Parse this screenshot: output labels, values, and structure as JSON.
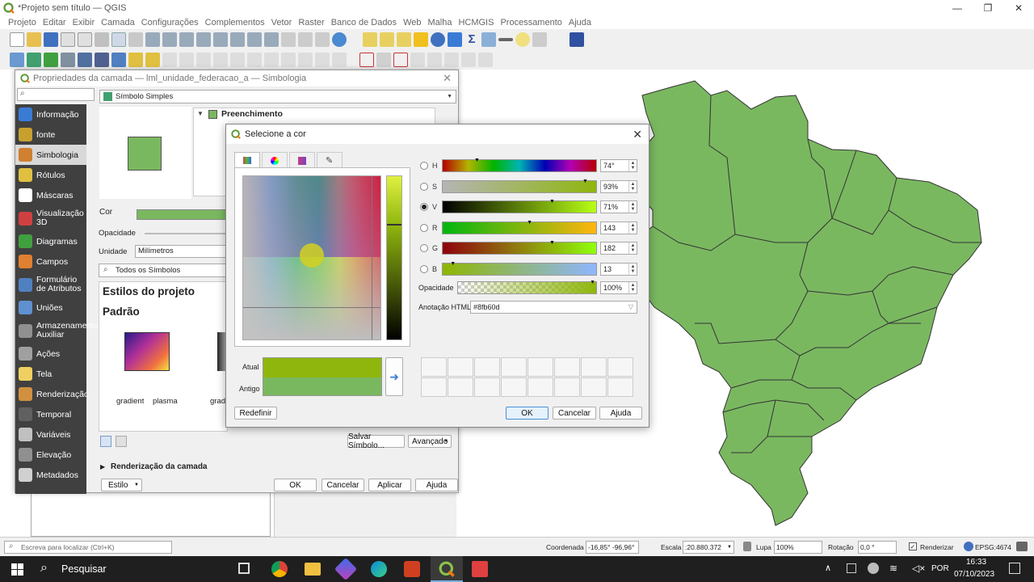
{
  "window": {
    "title": "*Projeto sem título — QGIS",
    "controls": [
      "—",
      "❐",
      "✕"
    ]
  },
  "menu": [
    "Projeto",
    "Editar",
    "Exibir",
    "Camada",
    "Configurações",
    "Complementos",
    "Vetor",
    "Raster",
    "Banco de Dados",
    "Web",
    "Malha",
    "HCMGIS",
    "Processamento",
    "Ajuda"
  ],
  "layer_props": {
    "title": "Propriedades da camada — lml_unidade_federacao_a — Simbologia",
    "renderer": "Símbolo Simples",
    "tree_item": "Preenchimento",
    "sidebar": [
      {
        "label": "Informação",
        "icon": "info-icon",
        "color": "#3a7bd5"
      },
      {
        "label": "fonte",
        "icon": "source-icon",
        "color": "#c8a030"
      },
      {
        "label": "Simbologia",
        "icon": "paintbrush-icon",
        "color": "#d08030",
        "selected": true
      },
      {
        "label": "Rótulos",
        "icon": "abc-label-icon",
        "color": "#e0c040"
      },
      {
        "label": "Máscaras",
        "icon": "abc-mask-icon",
        "color": "#ffffff"
      },
      {
        "label": "Visualização 3D",
        "icon": "cube-3d-icon",
        "color": "#d04040"
      },
      {
        "label": "Diagramas",
        "icon": "diagram-icon",
        "color": "#40a040"
      },
      {
        "label": "Campos",
        "icon": "fields-icon",
        "color": "#e08030"
      },
      {
        "label": "Formulário de Atributos",
        "icon": "form-icon",
        "color": "#5080c0"
      },
      {
        "label": "Uniões",
        "icon": "join-icon",
        "color": "#6090d0"
      },
      {
        "label": "Armazenamento Auxiliar",
        "icon": "storage-icon",
        "color": "#909090"
      },
      {
        "label": "Ações",
        "icon": "actions-icon",
        "color": "#a0a0a0"
      },
      {
        "label": "Tela",
        "icon": "tooltip-icon",
        "color": "#f0d060"
      },
      {
        "label": "Renderização",
        "icon": "render-brush-icon",
        "color": "#d09040"
      },
      {
        "label": "Temporal",
        "icon": "clock-icon",
        "color": "#606060"
      },
      {
        "label": "Variáveis",
        "icon": "variables-icon",
        "color": "#c0c0c0"
      },
      {
        "label": "Elevação",
        "icon": "elevation-icon",
        "color": "#909090"
      },
      {
        "label": "Metadados",
        "icon": "metadata-icon",
        "color": "#d0d0d0"
      }
    ],
    "labels": {
      "color": "Cor",
      "opacity": "Opacidade",
      "unit": "Unidade",
      "unit_value": "Milímetros",
      "all_symbols": "Todos os Símbolos",
      "project_styles": "Estilos do projeto",
      "default": "Padrão",
      "grad1": "gradient",
      "grad2": "plasma",
      "grad3": "grad",
      "save_symbol": "Salvar Símbolo...",
      "advanced": "Avançado",
      "layer_render": "Renderização da camada",
      "style": "Estilo",
      "ok": "OK",
      "cancel": "Cancelar",
      "apply": "Aplicar",
      "help": "Ajuda"
    },
    "fill_color": "#7ab860"
  },
  "color_dialog": {
    "title": "Selecione a cor",
    "channels": [
      {
        "key": "H",
        "value": "74°",
        "checked": false,
        "fraction": 0.21
      },
      {
        "key": "S",
        "value": "93%",
        "checked": false,
        "fraction": 0.93
      },
      {
        "key": "V",
        "value": "71%",
        "checked": true,
        "fraction": 0.71
      },
      {
        "key": "R",
        "value": "143",
        "checked": false,
        "fraction": 0.56
      },
      {
        "key": "G",
        "value": "182",
        "checked": false,
        "fraction": 0.71
      },
      {
        "key": "B",
        "value": "13",
        "checked": false,
        "fraction": 0.05
      }
    ],
    "opacity_label": "Opacidade",
    "opacity_value": "100%",
    "html_label": "Anotação HTML",
    "html_value": "#8fb60d",
    "current_label": "Atual",
    "old_label": "Antigo",
    "current_color": "#8fb60d",
    "old_color": "#7ab860",
    "reset": "Redefinir",
    "ok": "OK",
    "cancel": "Cancelar",
    "help": "Ajuda"
  },
  "statusbar": {
    "locate_placeholder": "Escreva para localizar (Ctrl+K)",
    "coord_label": "Coordenada",
    "coord_value": "-16,85° -96,96°",
    "scale_label": "Escala",
    "scale_value": ":20.880.372",
    "magnifier_label": "Lupa",
    "magnifier_value": "100%",
    "rotation_label": "Rotação",
    "rotation_value": "0,0 °",
    "render_label": "Renderizar",
    "crs": "EPSG:4674"
  },
  "taskbar": {
    "search": "Pesquisar",
    "lang": "POR",
    "time": "16:33",
    "date": "07/10/2023"
  },
  "map": {
    "fill": "#7ab860"
  }
}
